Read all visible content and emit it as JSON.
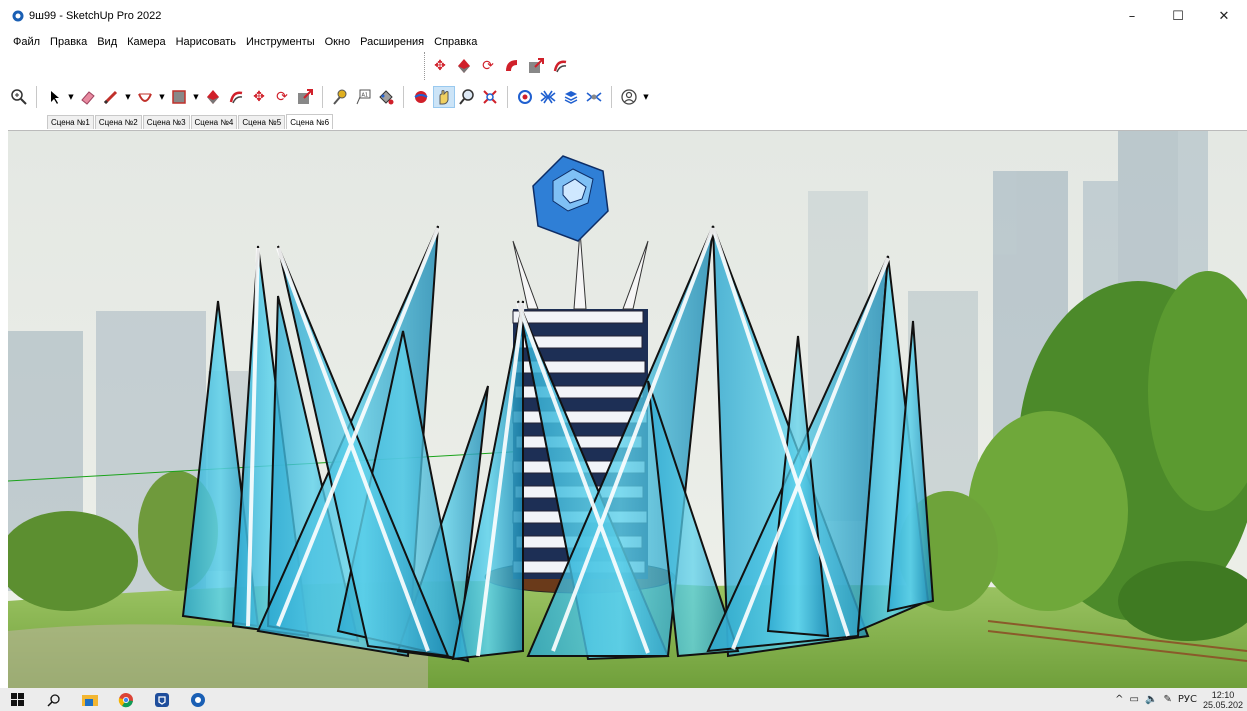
{
  "window": {
    "title": "9ш99 - SketchUp Pro 2022",
    "controls": {
      "minimize": "–",
      "maximize": "☐",
      "close": "✕"
    }
  },
  "menu": [
    {
      "label": "Файл"
    },
    {
      "label": "Правка"
    },
    {
      "label": "Вид"
    },
    {
      "label": "Камера"
    },
    {
      "label": "Нарисовать"
    },
    {
      "label": "Инструменты"
    },
    {
      "label": "Окно"
    },
    {
      "label": "Расширения"
    },
    {
      "label": "Справка"
    }
  ],
  "floating_toolbar": {
    "icons": [
      "move-icon",
      "push-pull-icon",
      "rotate-icon",
      "follow-me-icon",
      "scale-icon",
      "offset-icon"
    ]
  },
  "main_toolbar": {
    "icons": [
      "zoom-icon",
      "select-icon",
      "eraser-icon",
      "pencil-icon",
      "arc-icon",
      "rectangle-icon",
      "push-pull-icon",
      "offset-icon",
      "move-icon",
      "rotate-icon",
      "scale-icon",
      "tape-measure-icon",
      "text-icon",
      "paint-bucket-icon",
      "orbit-icon",
      "pan-icon",
      "zoom-icon",
      "zoom-extents-icon",
      "warehouse-icon",
      "extension-warehouse-icon",
      "layout-icon",
      "extension-manager-icon",
      "account-icon"
    ]
  },
  "scenes": [
    {
      "label": "Сцена №1",
      "active": false
    },
    {
      "label": "Сцена №2",
      "active": false
    },
    {
      "label": "Сцена №3",
      "active": false
    },
    {
      "label": "Сцена №4",
      "active": false
    },
    {
      "label": "Сцена №5",
      "active": false
    },
    {
      "label": "Сцена №6",
      "active": true
    }
  ],
  "taskbar": {
    "apps": [
      "windows-start-icon",
      "search-icon",
      "file-explorer-icon",
      "chrome-icon",
      "app-shield-icon",
      "sketchup-icon"
    ],
    "tray": {
      "language": "РУС",
      "time": "12:10",
      "date": "25.05.202"
    }
  },
  "colors": {
    "glass": "#3ec3e0",
    "glass_dark": "#1e8fb8",
    "cube": "#2f7fd6",
    "sky": "#e6e9e4",
    "grass": "#8fbf55",
    "green_axis": "#1aa31a"
  }
}
